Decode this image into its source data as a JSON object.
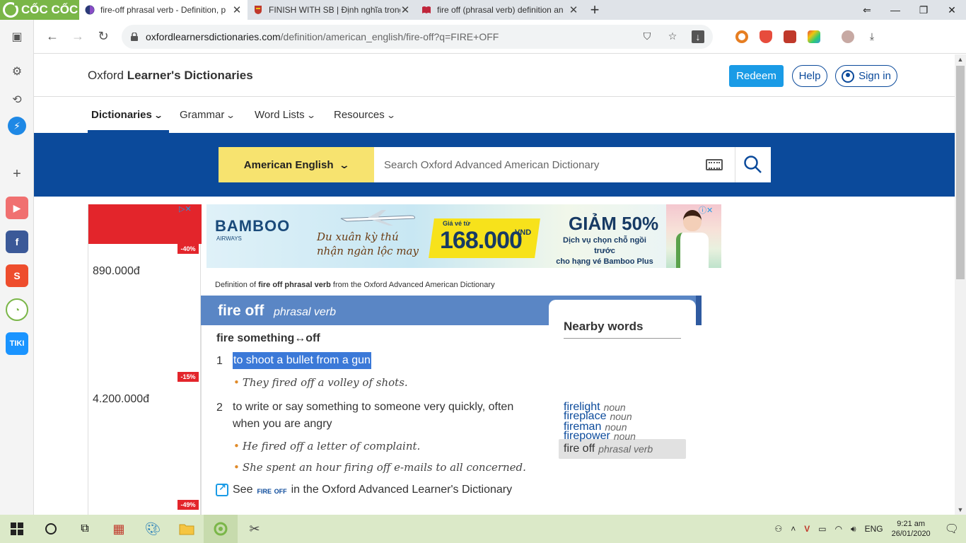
{
  "browser": {
    "logo_text": "CỐC CỐC",
    "tabs": [
      {
        "title": "fire-off phrasal verb - Definition, p",
        "active": true
      },
      {
        "title": "FINISH WITH SB | Định nghĩa trong",
        "active": false
      },
      {
        "title": "fire off (phrasal verb) definition an",
        "active": false
      }
    ],
    "url_host": "oxfordlearnersdictionaries.com",
    "url_path": "/definition/american_english/fire-off?q=FIRE+OFF"
  },
  "site": {
    "title_plain": "Oxford ",
    "title_bold": "Learner's Dictionaries",
    "redeem_label": "Redeem",
    "help_label": "Help",
    "signin_label": "Sign in",
    "menu": [
      "Dictionaries",
      "Grammar",
      "Word Lists",
      "Resources"
    ],
    "dict_select_label": "American English",
    "search_placeholder": "Search Oxford Advanced American Dictionary"
  },
  "ads": {
    "left_discounts": [
      "-40%",
      "-15%",
      "-49%"
    ],
    "left_prices": [
      "890.000đ",
      "4.200.000đ"
    ],
    "banner_brand": "BAMBOO",
    "banner_airways": "AIRWAYS",
    "banner_slogan_1": "Du xuân kỳ thú",
    "banner_slogan_2": "nhận ngàn lộc may",
    "banner_from": "Giá vé từ",
    "banner_price": "168.000",
    "banner_currency": "VND",
    "banner_sale": "GIẢM 50%",
    "banner_sale_sub_1": "Dịch vụ chọn chỗ ngồi trước",
    "banner_sale_sub_2": "cho hạng vé Bamboo Plus"
  },
  "entry": {
    "defof_prefix": "Definition of ",
    "defof_word": "fire off phrasal verb",
    "defof_suffix": " from the Oxford Advanced American Dictionary",
    "headword": "fire off",
    "pos": "phrasal verb",
    "idiom": "fire something↔off",
    "senses": [
      {
        "num": "1",
        "def": "to shoot a bullet from a gun",
        "examples": [
          "They fired off a volley of shots."
        ]
      },
      {
        "num": "2",
        "def_line1": "to write or say something to someone very quickly, often",
        "def_line2": "when you are angry",
        "examples": [
          "He fired off a letter of complaint.",
          "She spent an hour firing off e-mails to all concerned."
        ]
      }
    ],
    "see_prefix": "See ",
    "see_word": "fire off",
    "see_suffix": " in the Oxford Advanced Learner's Dictionary"
  },
  "nearby": {
    "title": "Nearby words",
    "items": [
      {
        "word": "firelight",
        "pos": "noun"
      },
      {
        "word": "fireman",
        "pos": "noun"
      },
      {
        "word": "fire off",
        "pos": "phrasal verb"
      },
      {
        "word": "fireplace",
        "pos": "noun"
      },
      {
        "word": "firepower",
        "pos": "noun"
      }
    ]
  },
  "taskbar": {
    "lang": "ENG",
    "time": "9:21 am",
    "date": "26/01/2020"
  },
  "colors": {
    "oxford_blue": "#0b4a9b",
    "entry_header": "#5a86c5",
    "selection": "#3b79d8",
    "dict_select": "#f7e36f",
    "coccoc_green": "#7ab648"
  }
}
